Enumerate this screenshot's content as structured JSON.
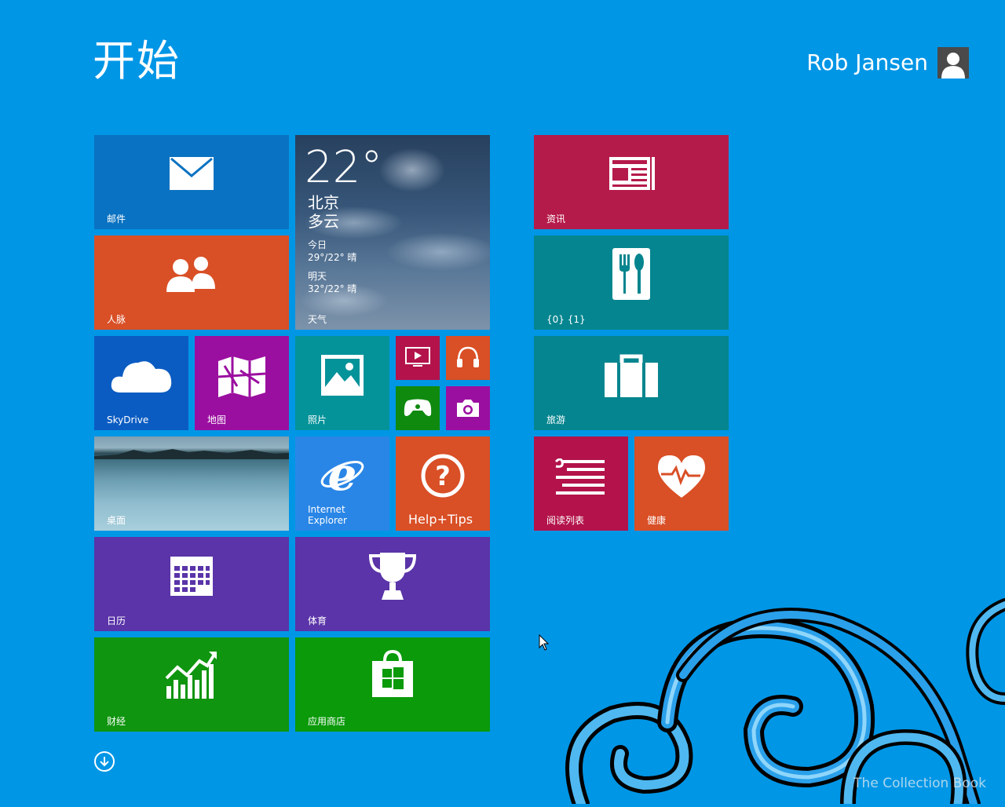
{
  "start": {
    "title": "开始"
  },
  "user": {
    "name": "Rob Jansen"
  },
  "tiles": {
    "mail": "邮件",
    "people": "人脉",
    "weather": {
      "label": "天气",
      "temp": "22°",
      "city": "北京",
      "condition": "多云",
      "today_label": "今日",
      "today_value": "29°/22° 晴",
      "tomorrow_label": "明天",
      "tomorrow_value": "32°/22° 晴"
    },
    "news": "资讯",
    "food": "{0} {1}",
    "skydrive": "SkyDrive",
    "maps": "地图",
    "photos": "照片",
    "travel": "旅游",
    "desktop": "桌面",
    "ie_line1": "Internet",
    "ie_line2": "Explorer",
    "help": "Help+Tips",
    "reading_list": "阅读列表",
    "health": "健康",
    "calendar": "日历",
    "sports": "体育",
    "finance": "财经",
    "store": "应用商店"
  },
  "watermark": "The Collection Book",
  "colors": {
    "background": "#0096e6",
    "mail": "#0a72c2",
    "people": "#d94f26",
    "news": "#b51b4a",
    "food": "#05858f",
    "travel": "#05858f",
    "skydrive": "#0b5cc2",
    "maps": "#9b0fa0",
    "photos": "#05939a",
    "video": "#b3134a",
    "music": "#d94f26",
    "games": "#0f8a0f",
    "camera": "#9b0fa0",
    "ie": "#2a86e6",
    "help": "#d94f26",
    "reading_list": "#b3134a",
    "health": "#d94f26",
    "calendar": "#5a34a8",
    "sports": "#5a34a8",
    "finance": "#0f950f",
    "store": "#0a9a0a"
  }
}
